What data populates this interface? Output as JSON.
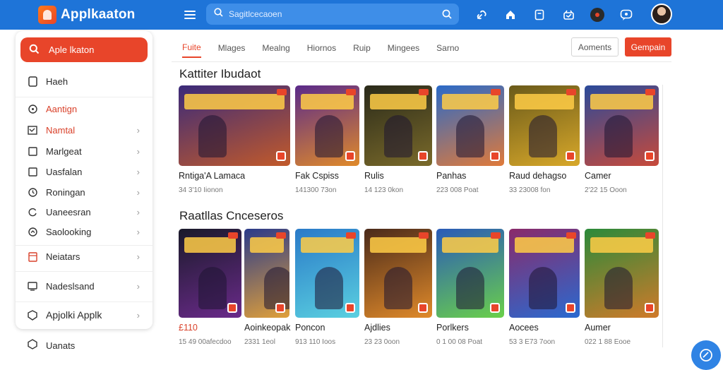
{
  "app": {
    "logo_text": "Applkaaton"
  },
  "search": {
    "placeholder": "Sagitlcecaoen"
  },
  "topbar_icons": [
    "link-icon",
    "home-icon",
    "bookmark-icon",
    "gift-icon",
    "record-icon",
    "chat-icon"
  ],
  "sidebar": {
    "primary": "Aple lkaton",
    "items": [
      {
        "label": "Haeh",
        "icon": "document-icon"
      },
      {
        "label": "Aantign",
        "icon": "compass-icon"
      },
      {
        "label": "Namtal",
        "icon": "chart-icon"
      },
      {
        "label": "Marlgeat",
        "icon": "square-icon"
      },
      {
        "label": "Uasfalan",
        "icon": "square-icon"
      },
      {
        "label": "Roningan",
        "icon": "clock-icon"
      },
      {
        "label": "Uaneesran",
        "icon": "refresh-icon"
      },
      {
        "label": "Saolooking",
        "icon": "gauge-icon"
      },
      {
        "label": "Neiatars",
        "icon": "grid-icon"
      },
      {
        "label": "Nadeslsand",
        "icon": "monitor-icon"
      },
      {
        "label": "Apjolki Applk",
        "icon": "shield-icon"
      }
    ],
    "bottom": "Uanats"
  },
  "tabs": [
    "Fuite",
    "Mlages",
    "Mealng",
    "Hiornos",
    "Ruip",
    "Mingees",
    "Sarno"
  ],
  "buttons": {
    "outline": "Aoments",
    "primary": "Gempain"
  },
  "sections": [
    {
      "title": "Kattiter Ibudaot",
      "cards": [
        {
          "title": "Rntiga'A Lamaca",
          "meta": "34 3'10 Iionon",
          "colors": [
            "#3a2a7a",
            "#c25a2a"
          ]
        },
        {
          "title": "Fak Cspiss",
          "meta": "141300 73on",
          "colors": [
            "#5a2a8a",
            "#e08a2a"
          ]
        },
        {
          "title": "Rulis",
          "meta": "14 123 0kon",
          "colors": [
            "#2a2a1a",
            "#7a6a2a"
          ]
        },
        {
          "title": "Panhas",
          "meta": "223 008 Poat",
          "colors": [
            "#2a6ac8",
            "#e07a3a"
          ]
        },
        {
          "title": "Raud dehagso",
          "meta": "33 23008 fon",
          "colors": [
            "#6a5a1a",
            "#d8a82a"
          ]
        },
        {
          "title": "Camer",
          "meta": "2'22 15 Ooon",
          "colors": [
            "#2a4a9a",
            "#c84a3a"
          ]
        }
      ]
    },
    {
      "title": "Raatllas Cnceseros",
      "cards": [
        {
          "title": "£110",
          "meta": "15 49 00afecdoo",
          "colors": [
            "#1a1a2a",
            "#6a2a8a"
          ]
        },
        {
          "title": "Aoinkeopak",
          "meta": "2331 1eol",
          "colors": [
            "#2a3a8a",
            "#e0a03a"
          ]
        },
        {
          "title": "Poncon",
          "meta": "913 110 Ioos",
          "colors": [
            "#2a7ac8",
            "#5ad0e0"
          ]
        },
        {
          "title": "Ajdlies",
          "meta": "23 23 0oon",
          "colors": [
            "#4a2a1a",
            "#e08a2a"
          ]
        },
        {
          "title": "Porlkers",
          "meta": "0 1 00 08 Poat",
          "colors": [
            "#2a5ab8",
            "#6ad04a"
          ]
        },
        {
          "title": "Aocees",
          "meta": "53 3 E73 7oon",
          "colors": [
            "#8a2a6a",
            "#2a6ad0"
          ]
        },
        {
          "title": "Aumer",
          "meta": "022 1 88 Eooe",
          "colors": [
            "#2a8a3a",
            "#d07a2a"
          ]
        }
      ]
    }
  ]
}
